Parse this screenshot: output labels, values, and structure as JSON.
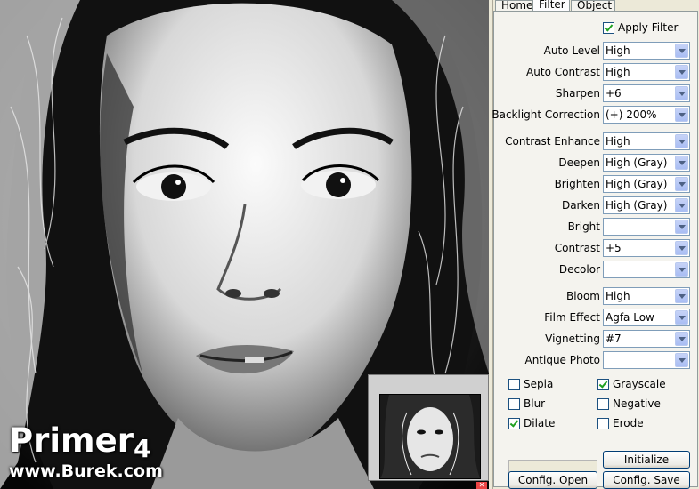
{
  "preview": {
    "watermark_title": "Primer",
    "watermark_version": "4",
    "watermark_site": "www.Burek.com"
  },
  "tabs": [
    {
      "label": "Home",
      "active": false
    },
    {
      "label": "Filter",
      "active": true
    },
    {
      "label": "Object",
      "active": false
    }
  ],
  "filter": {
    "apply_filter": {
      "label": "Apply Filter",
      "checked": true
    },
    "auto_level": {
      "label": "Auto Level",
      "value": "High"
    },
    "auto_contrast": {
      "label": "Auto Contrast",
      "value": "High"
    },
    "sharpen": {
      "label": "Sharpen",
      "value": "+6"
    },
    "backlight_correction": {
      "label": "Backlight Correction",
      "value": "(+) 200%"
    },
    "contrast_enhance": {
      "label": "Contrast Enhance",
      "value": "High"
    },
    "deepen": {
      "label": "Deepen",
      "value": "High (Gray)"
    },
    "brighten": {
      "label": "Brighten",
      "value": "High (Gray)"
    },
    "darken": {
      "label": "Darken",
      "value": "High (Gray)"
    },
    "bright": {
      "label": "Bright",
      "value": ""
    },
    "contrast": {
      "label": "Contrast",
      "value": "+5"
    },
    "decolor": {
      "label": "Decolor",
      "value": ""
    },
    "bloom": {
      "label": "Bloom",
      "value": "High"
    },
    "film_effect": {
      "label": "Film Effect",
      "value": "Agfa Low"
    },
    "vignetting": {
      "label": "Vignetting",
      "value": "#7"
    },
    "antique_photo": {
      "label": "Antique Photo",
      "value": ""
    }
  },
  "effects": {
    "sepia": {
      "label": "Sepia",
      "checked": false
    },
    "grayscale": {
      "label": "Grayscale",
      "checked": true
    },
    "blur": {
      "label": "Blur",
      "checked": false
    },
    "negative": {
      "label": "Negative",
      "checked": false
    },
    "dilate": {
      "label": "Dilate",
      "checked": true
    },
    "erode": {
      "label": "Erode",
      "checked": false
    }
  },
  "buttons": {
    "initialize": "Initialize",
    "config_open": "Config. Open",
    "config_save": "Config. Save"
  },
  "colors": {
    "panel_bg": "#f4f3ee",
    "window_bg": "#ece9d8",
    "checkmark": "#21a121"
  }
}
